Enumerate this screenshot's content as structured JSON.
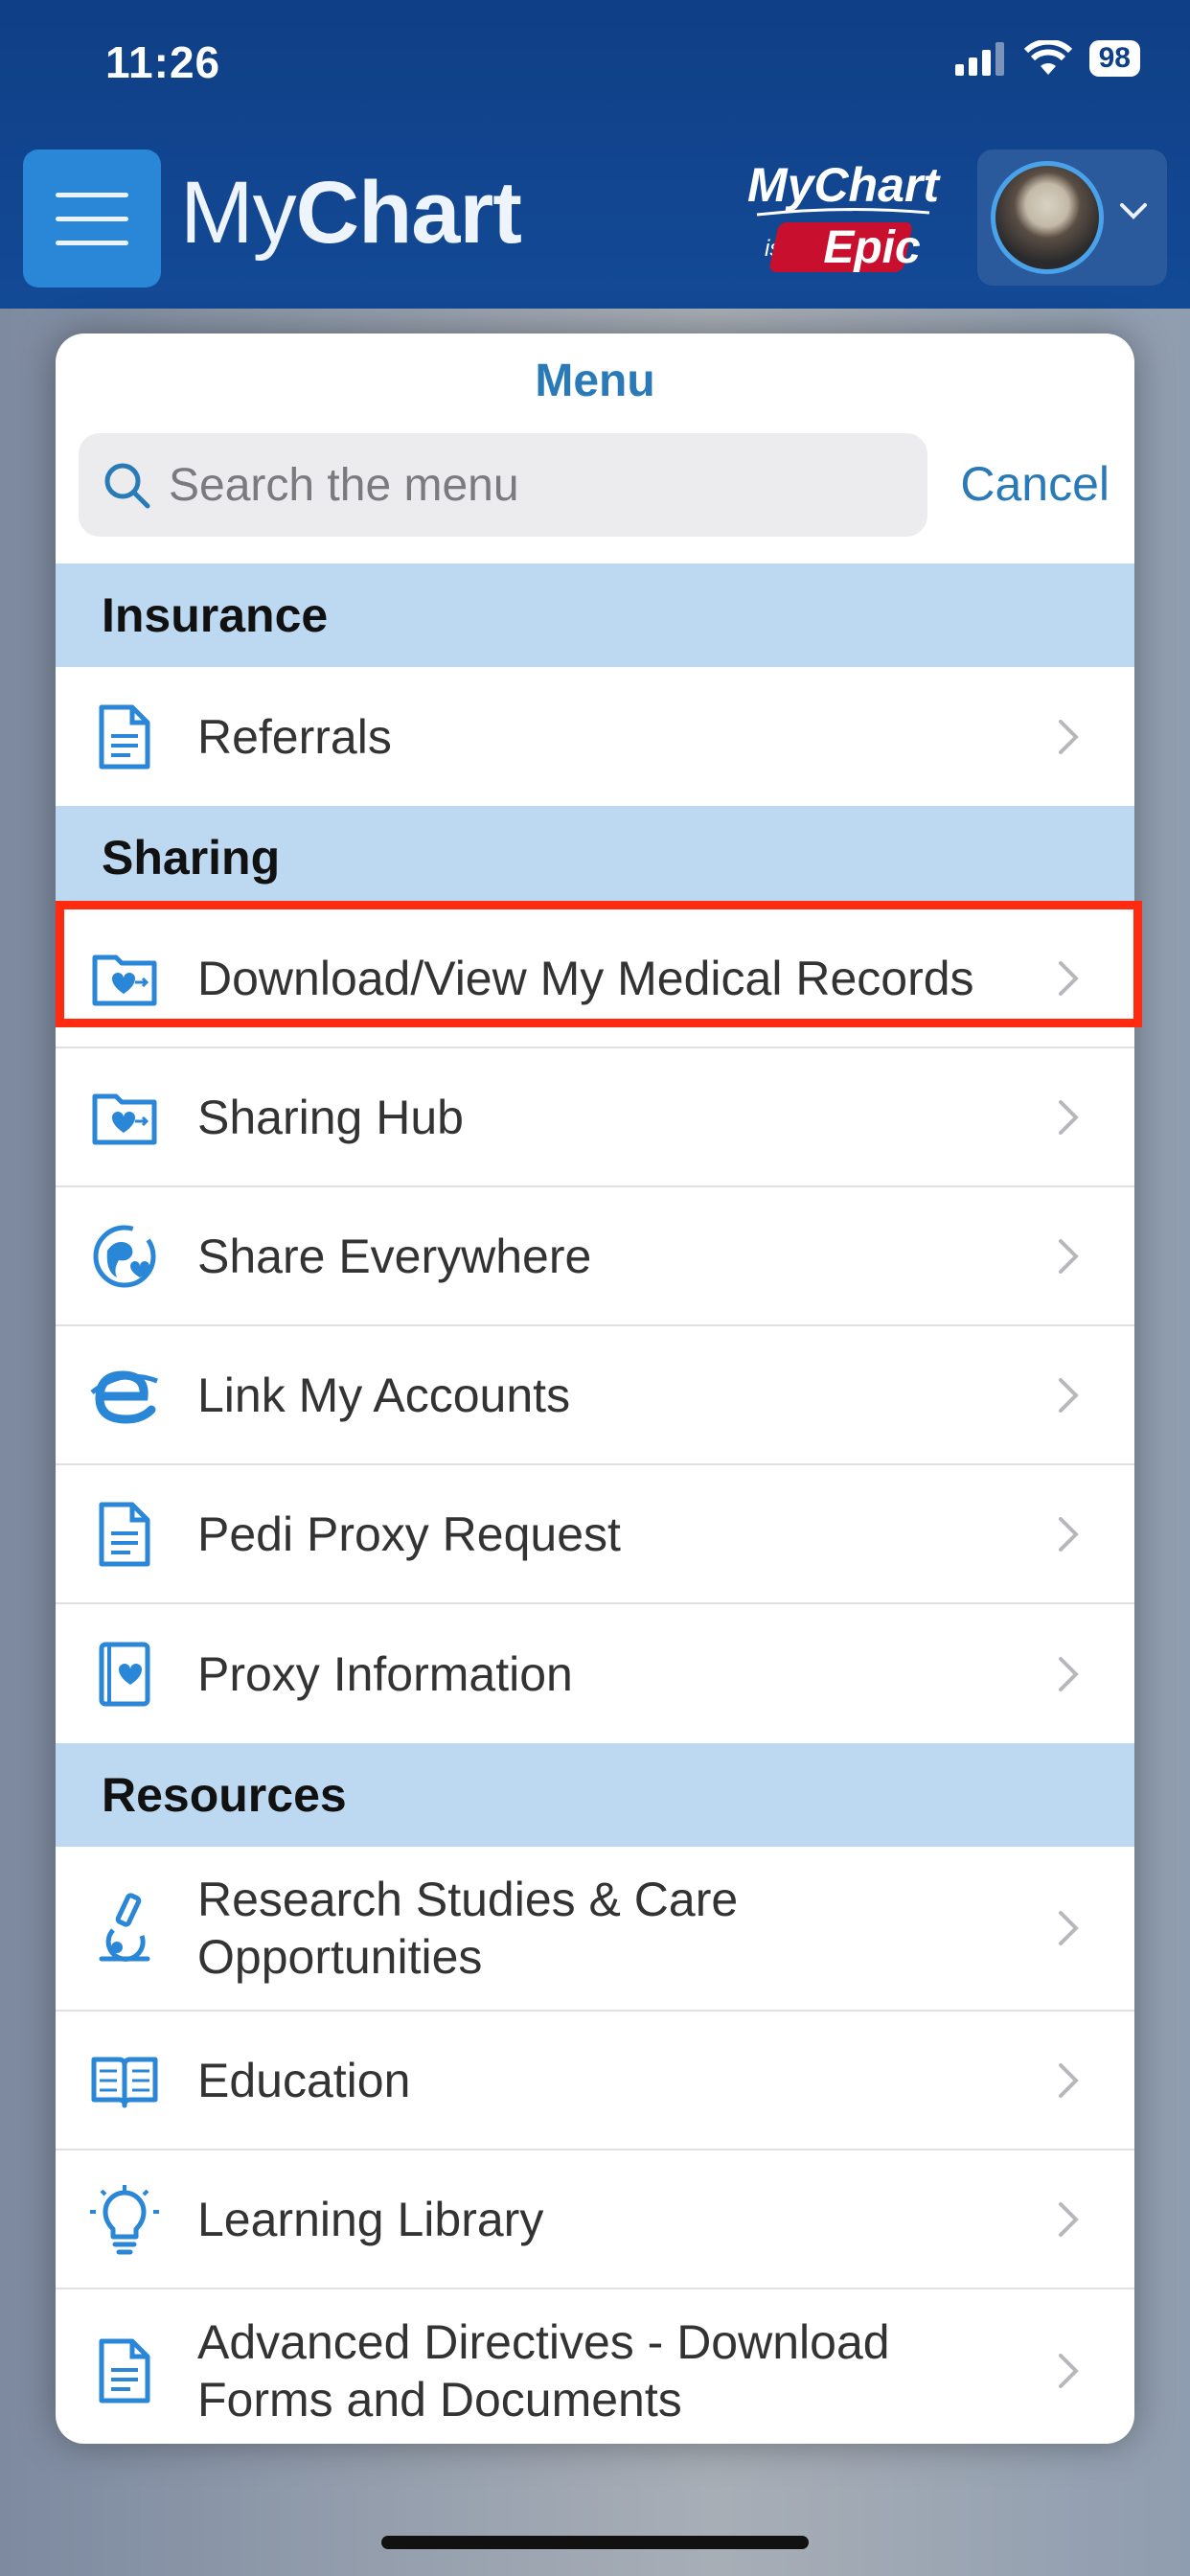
{
  "status_bar": {
    "time": "11:26",
    "battery": "98"
  },
  "header": {
    "brand_light": "My",
    "brand_bold": "Chart",
    "logo_top": "MyChart",
    "logo_is": "is",
    "logo_epic": "Epic"
  },
  "menu": {
    "title": "Menu",
    "search_placeholder": "Search the menu",
    "cancel_label": "Cancel"
  },
  "sections": {
    "insurance": "Insurance",
    "sharing": "Sharing",
    "resources": "Resources"
  },
  "items": {
    "referrals": "Referrals",
    "download_records": "Download/View My Medical Records",
    "sharing_hub": "Sharing Hub",
    "share_everywhere": "Share Everywhere",
    "link_accounts": "Link My Accounts",
    "pedi_proxy": "Pedi Proxy Request",
    "proxy_info": "Proxy Information",
    "research": "Research Studies & Care Opportunities",
    "education": "Education",
    "learning_library": "Learning Library",
    "advanced_directives": "Advanced Directives - Download Forms and Documents"
  },
  "colors": {
    "header": "#134a96",
    "accent": "#2a7ab8",
    "section_bg": "#bdd9f1",
    "highlight": "#ff2a0f",
    "icon": "#2a86d6"
  }
}
